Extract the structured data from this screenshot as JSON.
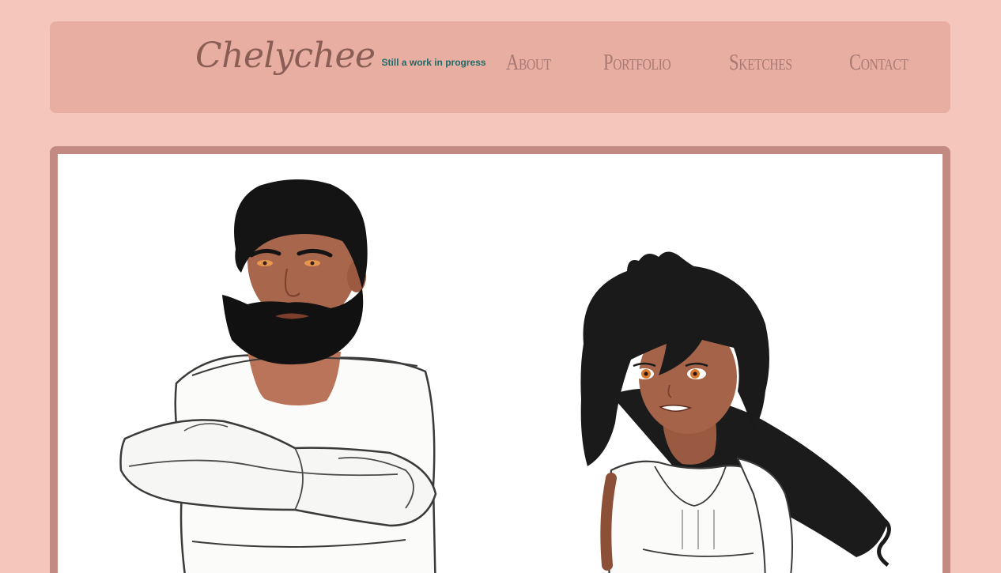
{
  "brand": {
    "title": "Chelychee",
    "tagline": "Still a work in progress"
  },
  "nav": {
    "items": [
      {
        "label": "About"
      },
      {
        "label": "Portfolio"
      },
      {
        "label": "Sketches"
      },
      {
        "label": "Contact"
      }
    ]
  },
  "colors": {
    "page_background": "#f5c7bc",
    "header_background": "#e8aea1",
    "brand_title": "#8a5d55",
    "tagline": "#1f6b68",
    "nav_text": "#a87a73",
    "frame_border": "#c38a82"
  },
  "artwork": {
    "figures": [
      "bearded-man-illustration",
      "dark-haired-woman-illustration"
    ]
  }
}
